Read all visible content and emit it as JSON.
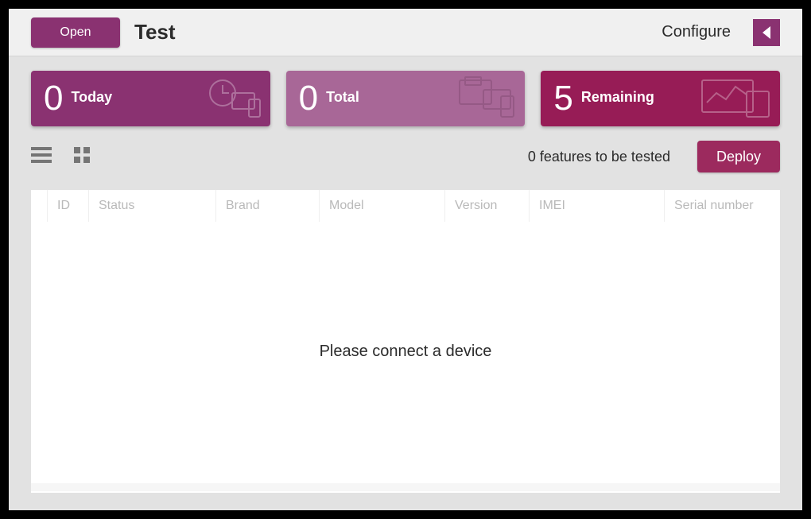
{
  "header": {
    "open_label": "Open",
    "title": "Test",
    "configure_label": "Configure"
  },
  "cards": {
    "today": {
      "value": "0",
      "label": "Today"
    },
    "total": {
      "value": "0",
      "label": "Total"
    },
    "remaining": {
      "value": "5",
      "label": "Remaining"
    }
  },
  "toolbar": {
    "status_text": "0 features to be tested",
    "deploy_label": "Deploy"
  },
  "table": {
    "columns": {
      "id": "ID",
      "status": "Status",
      "brand": "Brand",
      "model": "Model",
      "version": "Version",
      "imei": "IMEI",
      "serial": "Serial number"
    },
    "empty_message": "Please connect a device"
  },
  "colors": {
    "brand_purple": "#8a3271",
    "brand_purple_light": "#a86797",
    "brand_magenta": "#971c56",
    "deploy": "#9c2a5e"
  }
}
